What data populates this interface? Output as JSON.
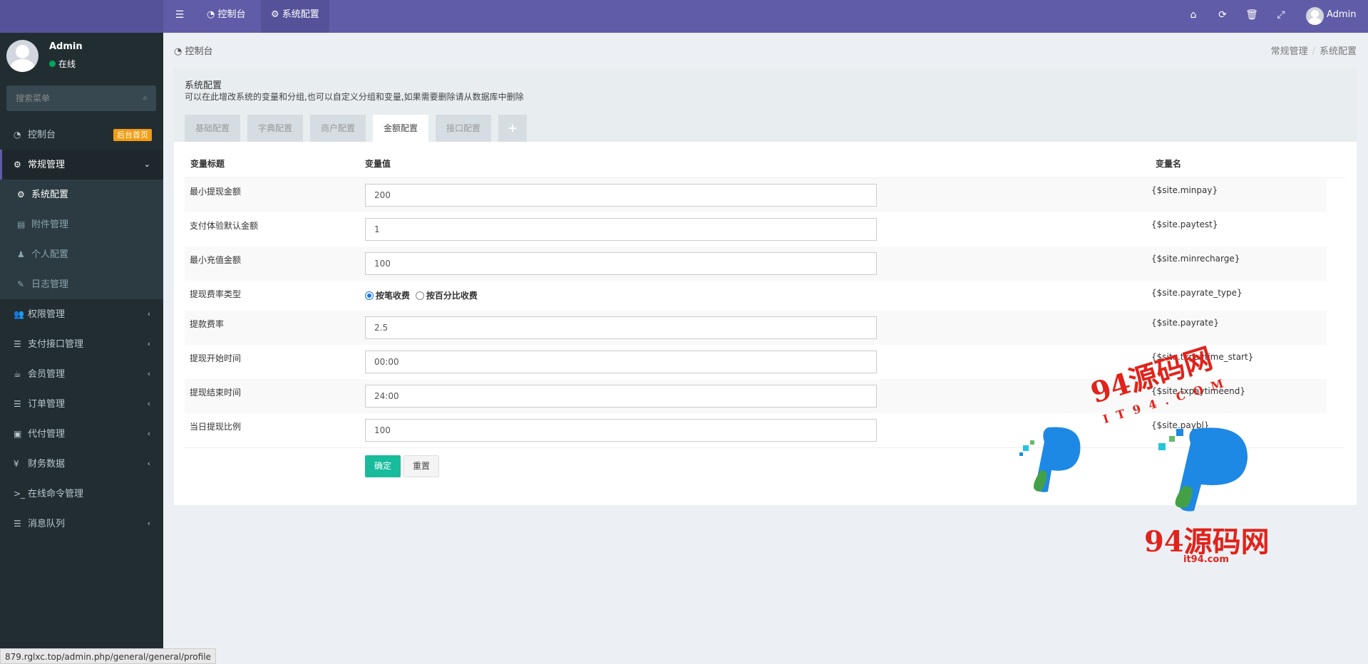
{
  "topbar": {
    "tabs": [
      {
        "icon": "dashboard-icon",
        "label": "控制台"
      },
      {
        "icon": "gear-icon",
        "label": "系统配置"
      }
    ],
    "user_label": "Admin"
  },
  "sidebar": {
    "user": {
      "name": "Admin",
      "status": "在线"
    },
    "search_placeholder": "搜索菜单",
    "items": [
      {
        "label": "控制台",
        "badge": "后台首页"
      },
      {
        "label": "常规管理"
      },
      {
        "label": "系统配置"
      },
      {
        "label": "附件管理"
      },
      {
        "label": "个人配置"
      },
      {
        "label": "日志管理"
      },
      {
        "label": "权限管理"
      },
      {
        "label": "支付接口管理"
      },
      {
        "label": "会员管理"
      },
      {
        "label": "订单管理"
      },
      {
        "label": "代付管理"
      },
      {
        "label": "财务数据"
      },
      {
        "label": "在线命令管理"
      },
      {
        "label": "消息队列"
      }
    ]
  },
  "breadcrumb": {
    "left": "控制台",
    "right": [
      "常规管理",
      "系统配置"
    ]
  },
  "panel": {
    "title": "系统配置",
    "description": "可以在此增改系统的变量和分组,也可以自定义分组和变量,如果需要删除请从数据库中删除",
    "tabs": [
      "基础配置",
      "字典配置",
      "商户配置",
      "金额配置",
      "接口配置"
    ],
    "active_tab": "金额配置",
    "table_headers": {
      "title": "变量标题",
      "value": "变量值",
      "name": "变量名"
    },
    "rows": [
      {
        "title": "最小提现金额",
        "value": "200",
        "var": "{$site.minpay}"
      },
      {
        "title": "支付体验默认金额",
        "value": "1",
        "var": "{$site.paytest}"
      },
      {
        "title": "最小充值金额",
        "value": "100",
        "var": "{$site.minrecharge}"
      },
      {
        "title": "提现费率类型",
        "var": "{$site.payrate_type}",
        "radio_options": [
          "按笔收费",
          "按百分比收费"
        ],
        "radio_selected": "按笔收费"
      },
      {
        "title": "提款费率",
        "value": "2.5",
        "var": "{$site.payrate}"
      },
      {
        "title": "提现开始时间",
        "value": "00:00",
        "var": "{$site.txpaytime_start}"
      },
      {
        "title": "提现结束时间",
        "value": "24:00",
        "var": "{$site.txpaytimeend}"
      },
      {
        "title": "当日提现比例",
        "value": "100",
        "var": "{$site.paybl}"
      }
    ],
    "buttons": {
      "confirm": "确定",
      "reset": "重置"
    }
  },
  "statusbar": {
    "url": "879.rglxc.top/admin.php/general/general/profile"
  },
  "watermark": {
    "text": "94源码网",
    "sub1": "IT94.COM",
    "sub2": "it94.com"
  },
  "colors": {
    "topbar": "#605ca8",
    "sidebar": "#222d32",
    "accent_green": "#18bc9c",
    "badge": "#f39c12"
  }
}
